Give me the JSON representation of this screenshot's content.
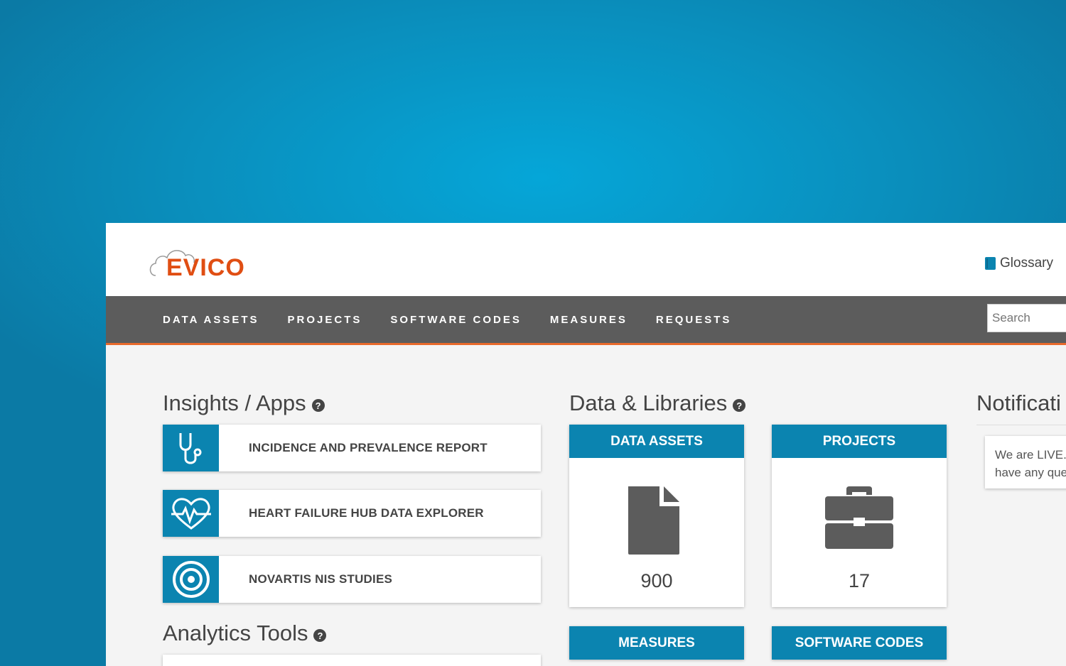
{
  "header": {
    "logo_text": "EVICO",
    "glossary_label": "Glossary"
  },
  "nav": {
    "items": [
      "DATA ASSETS",
      "PROJECTS",
      "SOFTWARE CODES",
      "MEASURES",
      "REQUESTS"
    ],
    "search_placeholder": "Search"
  },
  "insights": {
    "title": "Insights / Apps",
    "apps": [
      {
        "label": "INCIDENCE AND PREVALENCE REPORT",
        "icon": "stethoscope-icon"
      },
      {
        "label": "HEART FAILURE HUB DATA EXPLORER",
        "icon": "heartbeat-icon"
      },
      {
        "label": "NOVARTIS NIS STUDIES",
        "icon": "target-icon"
      }
    ]
  },
  "analytics": {
    "title": "Analytics Tools"
  },
  "libraries": {
    "title": "Data & Libraries",
    "tiles": [
      {
        "label": "DATA ASSETS",
        "count": "900",
        "icon": "file-icon"
      },
      {
        "label": "PROJECTS",
        "count": "17",
        "icon": "briefcase-icon"
      },
      {
        "label": "MEASURES",
        "icon": ""
      },
      {
        "label": "SOFTWARE CODES",
        "icon": ""
      }
    ]
  },
  "notifications": {
    "title": "Notificati",
    "message_line1": "We are LIVE.",
    "message_line2": "have any que"
  },
  "colors": {
    "accent_blue": "#0b84b0",
    "nav_gray": "#5c5c5c",
    "brand_orange": "#e04e13"
  }
}
